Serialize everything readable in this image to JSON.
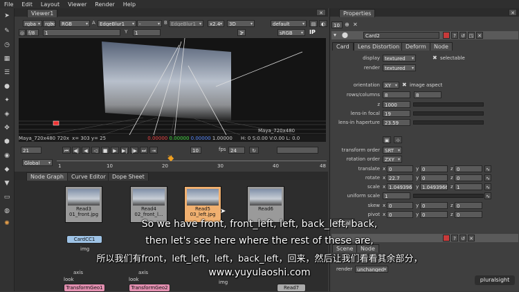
{
  "menu": [
    "File",
    "Edit",
    "Layout",
    "Viewer",
    "Render",
    "Help"
  ],
  "viewer": {
    "tab": "Viewer1",
    "row1": {
      "channels": "rgba",
      "layer": "rgba",
      "alpha": "RGB",
      "a_label": "A",
      "a_input": "EdgeBlur1",
      "dash": "-",
      "b_label": "B",
      "b_input": "EdgeBlur1",
      "zoom": "x2.4",
      "view": "3D",
      "lut": "default"
    },
    "row2": {
      "fstop": "f/8",
      "gain": "1",
      "y_label": "Y",
      "y_value": "1",
      "proxy": "1",
      "colorspace": "sRGB",
      "ip": "IP"
    },
    "format_tl": "Maya_720x480 720x",
    "format_tr": "Maya_720x480",
    "info": {
      "coords": "x= 303 y= 25",
      "r": "0.00000",
      "g": "0.00000",
      "b": "0.00000",
      "a": "1.00000",
      "hsv": "H: 0 S:0.00 V:0.00",
      "l": "L: 0.0"
    }
  },
  "timeline": {
    "frame": "21",
    "step": "10",
    "fps_label": "fps",
    "fps": "24",
    "range": "Global",
    "ticks": [
      "1",
      "10",
      "20",
      "30",
      "40",
      "48"
    ],
    "current": "21"
  },
  "nodegraph": {
    "tabs": [
      "Node Graph",
      "Curve Editor",
      "Dope Sheet"
    ],
    "nodes": [
      {
        "label": "Read3",
        "file": "01_front.jpg"
      },
      {
        "label": "Read4",
        "file": "02_front_l..."
      },
      {
        "label": "Read5",
        "file": "03_left.jpg"
      },
      {
        "label": "Read6",
        "file": ""
      }
    ],
    "cardcc": "CardCC1",
    "img": "img",
    "axis": "axis",
    "look": "look",
    "transform1": "TransformGeo1",
    "transform2": "TransformGeo2",
    "read7": "Read7"
  },
  "properties": {
    "tab": "Properties",
    "count": "10",
    "node_name": "Card2",
    "tabs": [
      "Card",
      "Lens Distortion",
      "Deform",
      "Node"
    ],
    "display_label": "display",
    "display": "textured",
    "selectable": "selectable",
    "render_label": "render",
    "render": "textured",
    "orientation_label": "orientation",
    "orientation": "XY",
    "image_aspect": "image aspect",
    "rows_label": "rows/columns",
    "rows": "8",
    "cols": "8",
    "z_label": "z",
    "z": "1000",
    "focal_label": "lens-in focal",
    "focal": "19",
    "haperture_label": "lens-in haperture",
    "haperture": "23.59",
    "transform_order_label": "transform order",
    "transform_order": "SRT",
    "rotation_order_label": "rotation order",
    "rotation_order": "ZXY",
    "translate_label": "translate",
    "translate": {
      "x": "0",
      "y": "0",
      "z": "0"
    },
    "rotate_label": "rotate",
    "rotate": {
      "x": "22.7",
      "y": "0",
      "z": "0"
    },
    "scale_label": "scale",
    "scale": {
      "x": "1.0493966",
      "y": "1.0493966",
      "z": "1"
    },
    "uniform_label": "uniform scale",
    "uniform": "1",
    "skew_label": "skew",
    "skew": {
      "x": "0",
      "y": "0",
      "z": "0"
    },
    "pivot_label": "pivot",
    "pivot": {
      "x": "0",
      "y": "0",
      "z": "0"
    },
    "axis_labels": {
      "x": "x",
      "y": "y",
      "z": "z"
    },
    "lower": {
      "local": "Local",
      "scene": "Scene",
      "node": "Node",
      "render_label": "render",
      "render": "unchanged"
    }
  },
  "subtitles": {
    "line1": "So we have front, front_left, left, back_left, back,",
    "line2": "then let's see here where the rest of these are,",
    "line3": "所以我们有front，left_left，left，back_left，回来，然后让我们看看其余部分，",
    "line4": "www.yuyulaoshi.com"
  },
  "watermark": "pluralsight",
  "colors": {
    "accent": "#e8a04a",
    "timeline_marker": "#f0a020",
    "header_red": "#c83a3a",
    "node_pink": "#e38fb0"
  }
}
